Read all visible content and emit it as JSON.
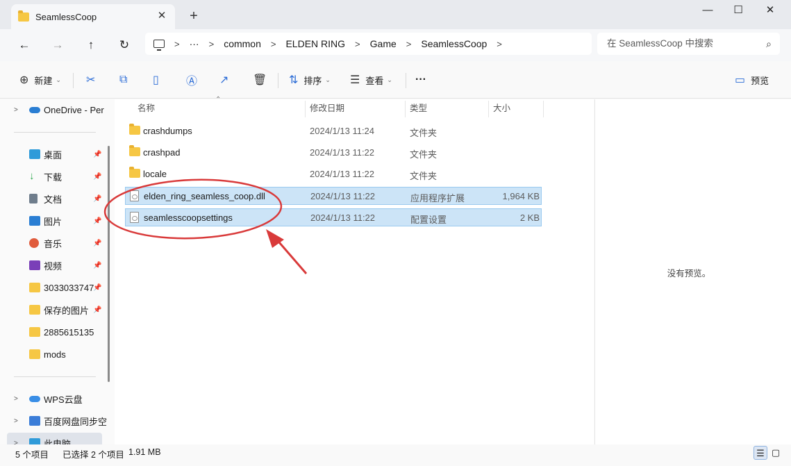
{
  "window": {
    "tab_title": "SeamlessCoop",
    "tab_close": "✕",
    "new_tab": "+",
    "controls": {
      "minimize": "—",
      "maximize": "☐",
      "close": "✕"
    }
  },
  "nav": {
    "back": "←",
    "forward": "→",
    "up": "↑",
    "refresh": "↻"
  },
  "address": {
    "overflow": "···",
    "segments": [
      "common",
      "ELDEN RING",
      "Game",
      "SeamlessCoop"
    ],
    "separator": ">"
  },
  "search": {
    "placeholder": "在 SeamlessCoop 中搜索"
  },
  "toolbar": {
    "new_label": "新建",
    "sort_label": "排序",
    "view_label": "查看",
    "more_label": "···",
    "preview_label": "预览"
  },
  "sidebar": {
    "onedrive": "OneDrive - Per",
    "items": [
      {
        "label": "桌面",
        "icon": "desktop-icon",
        "color": "#2f9bd9"
      },
      {
        "label": "下载",
        "icon": "download-icon",
        "color": "#2ea84f"
      },
      {
        "label": "文档",
        "icon": "document-icon",
        "color": "#6f7d8c"
      },
      {
        "label": "图片",
        "icon": "pictures-icon",
        "color": "#2a7ed3"
      },
      {
        "label": "音乐",
        "icon": "music-icon",
        "color": "#e05b3c"
      },
      {
        "label": "视频",
        "icon": "video-icon",
        "color": "#7a3fb8"
      },
      {
        "label": "3033033747",
        "icon": "folder-icon",
        "color": "#f6c744"
      },
      {
        "label": "保存的图片",
        "icon": "folder-icon",
        "color": "#f6c744"
      },
      {
        "label": "2885615135",
        "icon": "folder-icon",
        "color": "#f6c744"
      },
      {
        "label": "mods",
        "icon": "folder-icon",
        "color": "#f6c744"
      }
    ],
    "wps": "WPS云盘",
    "baidu": "百度网盘同步空",
    "thispc": "此电脑"
  },
  "columns": {
    "name": "名称",
    "date": "修改日期",
    "type": "类型",
    "size": "大小"
  },
  "files": [
    {
      "name": "crashdumps",
      "date": "2024/1/13 11:24",
      "type": "文件夹",
      "size": "",
      "kind": "folder",
      "selected": false
    },
    {
      "name": "crashpad",
      "date": "2024/1/13 11:22",
      "type": "文件夹",
      "size": "",
      "kind": "folder",
      "selected": false
    },
    {
      "name": "locale",
      "date": "2024/1/13 11:22",
      "type": "文件夹",
      "size": "",
      "kind": "folder",
      "selected": false
    },
    {
      "name": "elden_ring_seamless_coop.dll",
      "date": "2024/1/13 11:22",
      "type": "应用程序扩展",
      "size": "1,964 KB",
      "kind": "dll",
      "selected": true
    },
    {
      "name": "seamlesscoopsettings",
      "date": "2024/1/13 11:22",
      "type": "配置设置",
      "size": "2 KB",
      "kind": "settings",
      "selected": true
    }
  ],
  "preview": {
    "message": "没有预览。"
  },
  "status": {
    "count": "5 个项目",
    "selected": "已选择 2 个项目",
    "size": "1.91 MB"
  },
  "annotation_color": "#d93a3a"
}
